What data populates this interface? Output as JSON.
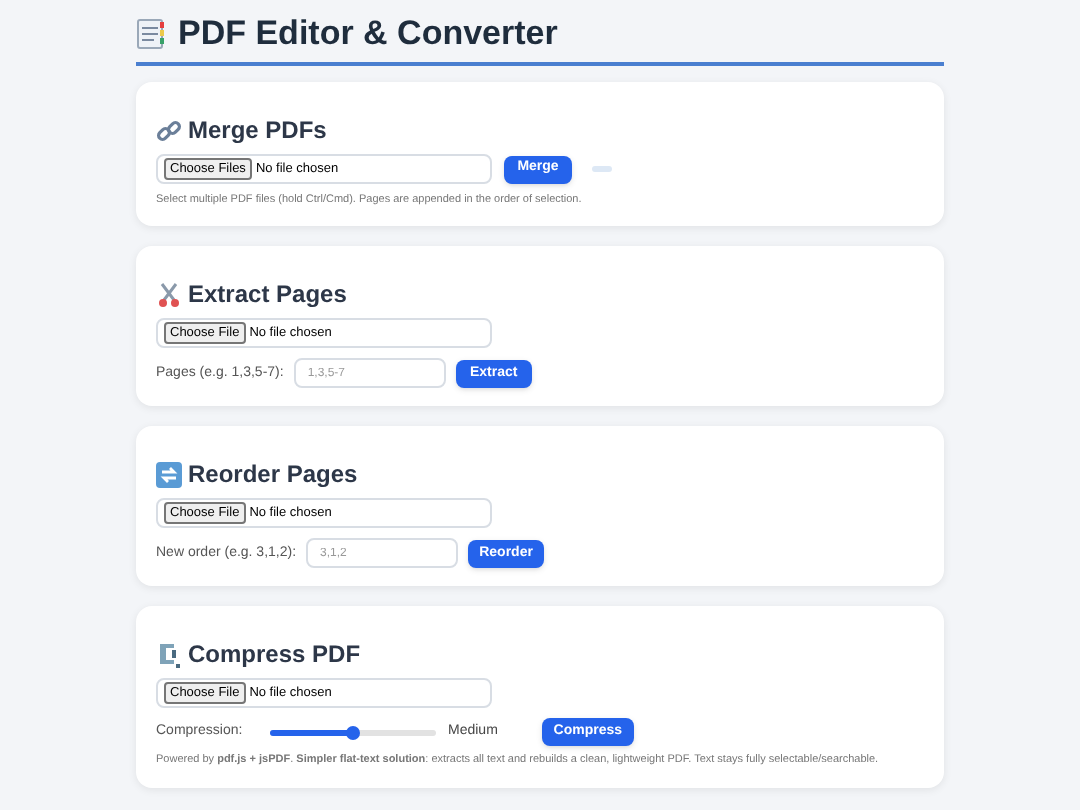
{
  "title": "PDF Editor & Converter",
  "cards": [
    {
      "kind": "merge",
      "heading": "Merge PDFs",
      "file": {
        "button": "Choose Files",
        "value": "No file chosen"
      },
      "action": "Merge",
      "hint": "Select multiple PDF files (hold Ctrl/Cmd). Pages are appended in the order of selection."
    },
    {
      "kind": "text-input",
      "heading": "Extract Pages",
      "file": {
        "button": "Choose File",
        "value": "No file chosen"
      },
      "label": "Pages (e.g. 1,3,5-7):",
      "placeholder": "1,3,5-7",
      "action": "Extract"
    },
    {
      "kind": "text-input",
      "heading": "Reorder Pages",
      "file": {
        "button": "Choose File",
        "value": "No file chosen"
      },
      "label": "New order (e.g. 3,1,2):",
      "placeholder": "3,1,2",
      "action": "Reorder"
    },
    {
      "kind": "slider",
      "heading": "Compress PDF",
      "file": {
        "button": "Choose File",
        "value": "No file chosen"
      },
      "label": "Compression:",
      "level": 0.5,
      "reading": "Medium",
      "action": "Compress",
      "note": "Powered by **pdf.js + jsPDF**. **Simpler flat-text solution**: extracts all text and rebuilds a clean, lightweight PDF. Text stays fully selectable/searchable."
    }
  ]
}
